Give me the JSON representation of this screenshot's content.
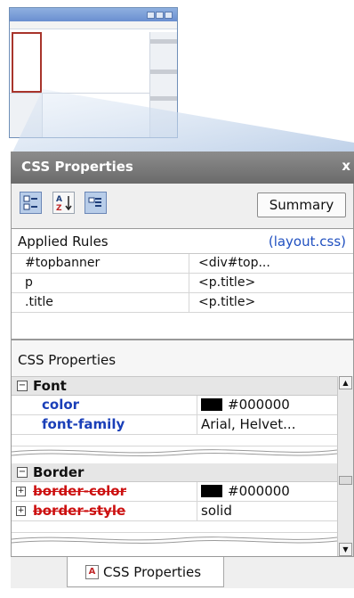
{
  "panel": {
    "title": "CSS Properties",
    "close_label": "x",
    "toolbar": {
      "buttons": [
        {
          "icon": "categorized-view-icon"
        },
        {
          "icon": "sort-alphabetical-icon",
          "text": "A Z"
        },
        {
          "icon": "show-set-properties-icon"
        }
      ],
      "summary_label": "Summary"
    },
    "applied_rules": {
      "header": "Applied Rules",
      "file_link": "(layout.css)",
      "rows": [
        {
          "rule": "#topbanner",
          "element": "<div#top..."
        },
        {
          "rule": "p",
          "element": "<p.title>"
        },
        {
          "rule": ".title",
          "element": "<p.title>"
        }
      ]
    },
    "css_properties": {
      "header": "CSS Properties",
      "font_category": "Font",
      "font_toggle": "−",
      "font_rows": [
        {
          "name": "color",
          "value": "#000000",
          "swatch": "#000000"
        },
        {
          "name": "font-family",
          "value": "Arial, Helvet..."
        }
      ],
      "border_category": "Border",
      "border_toggle": "−",
      "border_rows": [
        {
          "name": "border-color",
          "value": "#000000",
          "swatch": "#000000",
          "expand": "+"
        },
        {
          "name": "border-style",
          "value": "solid",
          "expand": "+"
        }
      ]
    },
    "tab": {
      "label": "CSS Properties",
      "icon_text": "A"
    }
  },
  "colors": {
    "title_bar": "#787878",
    "link": "#2050c0",
    "property_name": "#1a3fb8",
    "overridden_property": "#cc1010",
    "highlight_frame": "#a8342b"
  }
}
